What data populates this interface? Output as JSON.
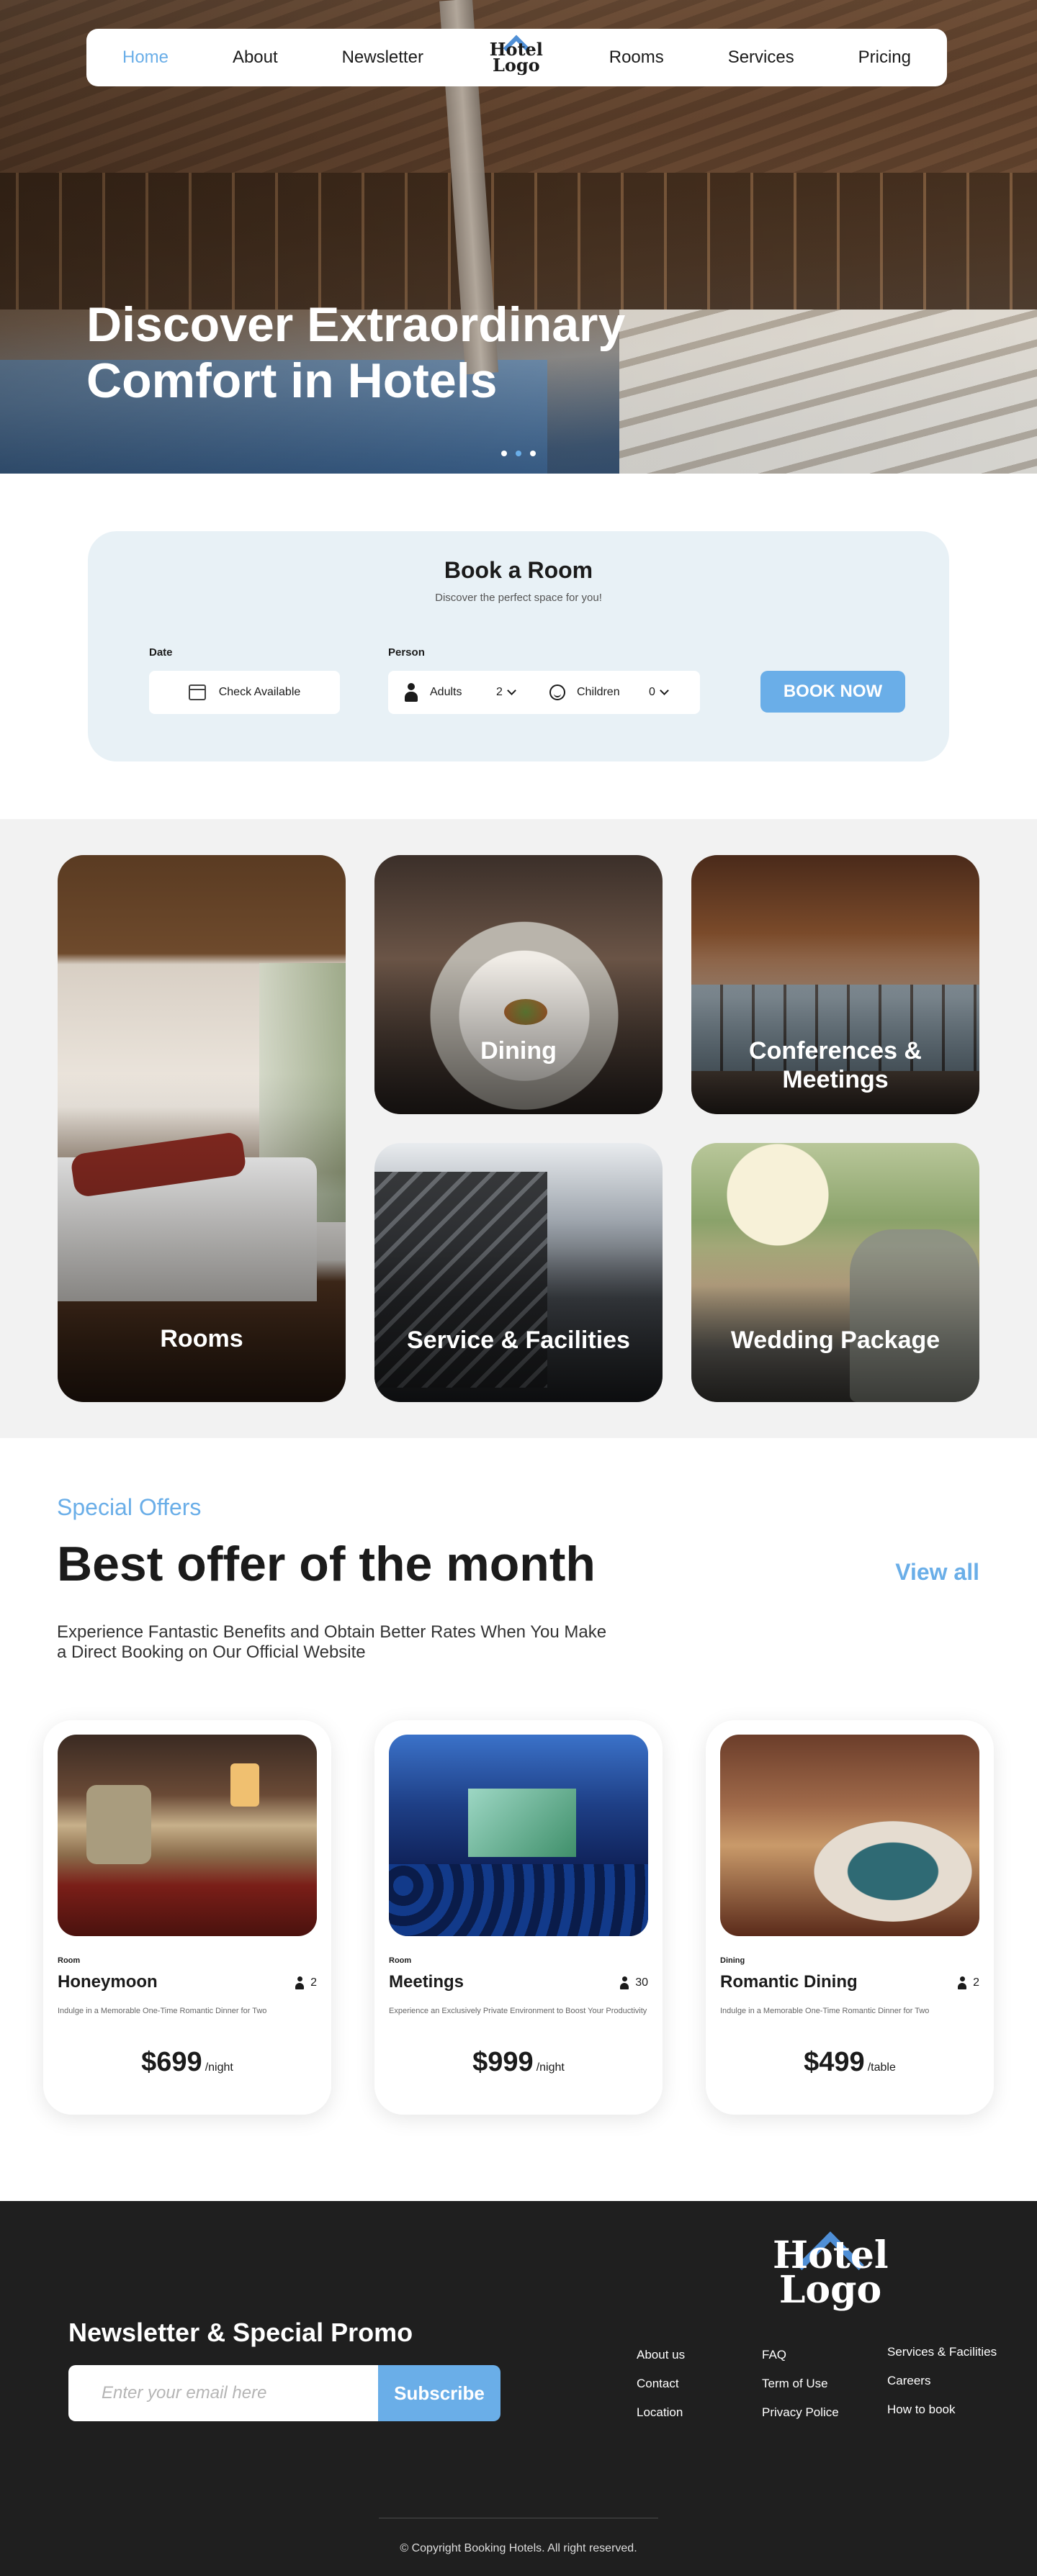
{
  "nav": {
    "items": [
      "Home",
      "About",
      "Newsletter",
      "Rooms",
      "Services",
      "Pricing"
    ],
    "active": "Home",
    "logo_line1": "Hotel",
    "logo_line2": "Logo"
  },
  "hero": {
    "title": "Discover Extraordinary Comfort in Hotels",
    "slides": 3,
    "active_slide": 2
  },
  "booking": {
    "title": "Book a Room",
    "subtitle": "Discover the perfect space for you!",
    "date_label": "Date",
    "date_value": "Check Available",
    "person_label": "Person",
    "adults_label": "Adults",
    "adults_value": "2",
    "children_label": "Children",
    "children_value": "0",
    "book_button": "BOOK NOW"
  },
  "categories": [
    {
      "label": "Rooms"
    },
    {
      "label": "Dining"
    },
    {
      "label": "Conferences & Meetings"
    },
    {
      "label": "Service & Facilities"
    },
    {
      "label": "Wedding Package"
    }
  ],
  "offers": {
    "kicker": "Special Offers",
    "heading": "Best offer of the month",
    "view_all": "View all",
    "description": "Experience Fantastic Benefits and Obtain Better Rates When You Make a Direct Booking on Our Official Website",
    "cards": [
      {
        "category": "Room",
        "name": "Honeymoon",
        "guests": "2",
        "description": "Indulge in a Memorable One-Time Romantic Dinner for Two",
        "price": "$699",
        "unit": "/night"
      },
      {
        "category": "Room",
        "name": "Meetings",
        "guests": "30",
        "description": "Experience an Exclusively Private Environment to Boost Your Productivity",
        "price": "$999",
        "unit": "/night"
      },
      {
        "category": "Dining",
        "name": "Romantic Dining",
        "guests": "2",
        "description": "Indulge in a Memorable One-Time Romantic Dinner for Two",
        "price": "$499",
        "unit": "/table"
      }
    ]
  },
  "footer": {
    "logo_line1": "Hotel",
    "logo_line2": "Logo",
    "newsletter_title": "Newsletter & Special Promo",
    "email_placeholder": "Enter your email here",
    "subscribe_button": "Subscribe",
    "columns": [
      [
        "About us",
        "Contact",
        "Location"
      ],
      [
        "FAQ",
        "Term of Use",
        "Privacy Police"
      ],
      [
        "Services & Facilities",
        "Careers",
        "How to book"
      ]
    ],
    "copyright": "© Copyright Booking Hotels. All right reserved."
  },
  "colors": {
    "accent": "#6aaee8",
    "logo_blue": "#4f8fd6",
    "booking_bg": "#e8f1f6",
    "category_bg": "#f2f2f2",
    "footer_bg": "#1f1f1f"
  }
}
